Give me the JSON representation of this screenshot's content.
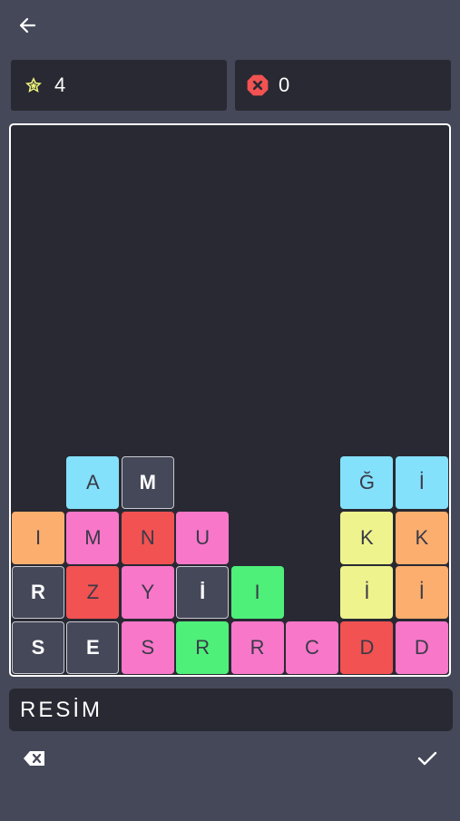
{
  "header": {
    "back_icon": "arrow-left-icon"
  },
  "stats": {
    "score": {
      "icon": "star-icon",
      "value": "4"
    },
    "errors": {
      "icon": "error-octagon-icon",
      "value": "0"
    }
  },
  "colors": {
    "cyan": "#84e1fb",
    "dark": "#454859",
    "orange": "#fbae6d",
    "pink": "#f877c9",
    "red": "#f25252",
    "green": "#4ef07a",
    "yellow": "#eef38d",
    "board_bg": "#282932",
    "page_bg": "#454859"
  },
  "board": {
    "columns": 8,
    "rows": 10,
    "tiles": [
      {
        "letter": "A",
        "col": 1,
        "row": 6,
        "color": "cyan"
      },
      {
        "letter": "M",
        "col": 2,
        "row": 6,
        "color": "dark"
      },
      {
        "letter": "Ğ",
        "col": 6,
        "row": 6,
        "color": "cyan"
      },
      {
        "letter": "İ",
        "col": 7,
        "row": 6,
        "color": "cyan"
      },
      {
        "letter": "I",
        "col": 0,
        "row": 7,
        "color": "orange"
      },
      {
        "letter": "M",
        "col": 1,
        "row": 7,
        "color": "pink"
      },
      {
        "letter": "N",
        "col": 2,
        "row": 7,
        "color": "red"
      },
      {
        "letter": "U",
        "col": 3,
        "row": 7,
        "color": "pink"
      },
      {
        "letter": "K",
        "col": 6,
        "row": 7,
        "color": "yellow"
      },
      {
        "letter": "K",
        "col": 7,
        "row": 7,
        "color": "orange"
      },
      {
        "letter": "R",
        "col": 0,
        "row": 8,
        "color": "dark"
      },
      {
        "letter": "Z",
        "col": 1,
        "row": 8,
        "color": "red"
      },
      {
        "letter": "Y",
        "col": 2,
        "row": 8,
        "color": "pink"
      },
      {
        "letter": "İ",
        "col": 3,
        "row": 8,
        "color": "dark"
      },
      {
        "letter": "I",
        "col": 4,
        "row": 8,
        "color": "green"
      },
      {
        "letter": "İ",
        "col": 6,
        "row": 8,
        "color": "yellow"
      },
      {
        "letter": "İ",
        "col": 7,
        "row": 8,
        "color": "orange"
      },
      {
        "letter": "S",
        "col": 0,
        "row": 9,
        "color": "dark"
      },
      {
        "letter": "E",
        "col": 1,
        "row": 9,
        "color": "dark"
      },
      {
        "letter": "S",
        "col": 2,
        "row": 9,
        "color": "pink"
      },
      {
        "letter": "R",
        "col": 3,
        "row": 9,
        "color": "green"
      },
      {
        "letter": "R",
        "col": 4,
        "row": 9,
        "color": "pink"
      },
      {
        "letter": "C",
        "col": 5,
        "row": 9,
        "color": "pink"
      },
      {
        "letter": "D",
        "col": 6,
        "row": 9,
        "color": "red"
      },
      {
        "letter": "D",
        "col": 7,
        "row": 9,
        "color": "pink"
      }
    ]
  },
  "answer": {
    "value": "RESİM"
  },
  "controls": {
    "delete_icon": "backspace-icon",
    "submit_icon": "check-icon"
  }
}
